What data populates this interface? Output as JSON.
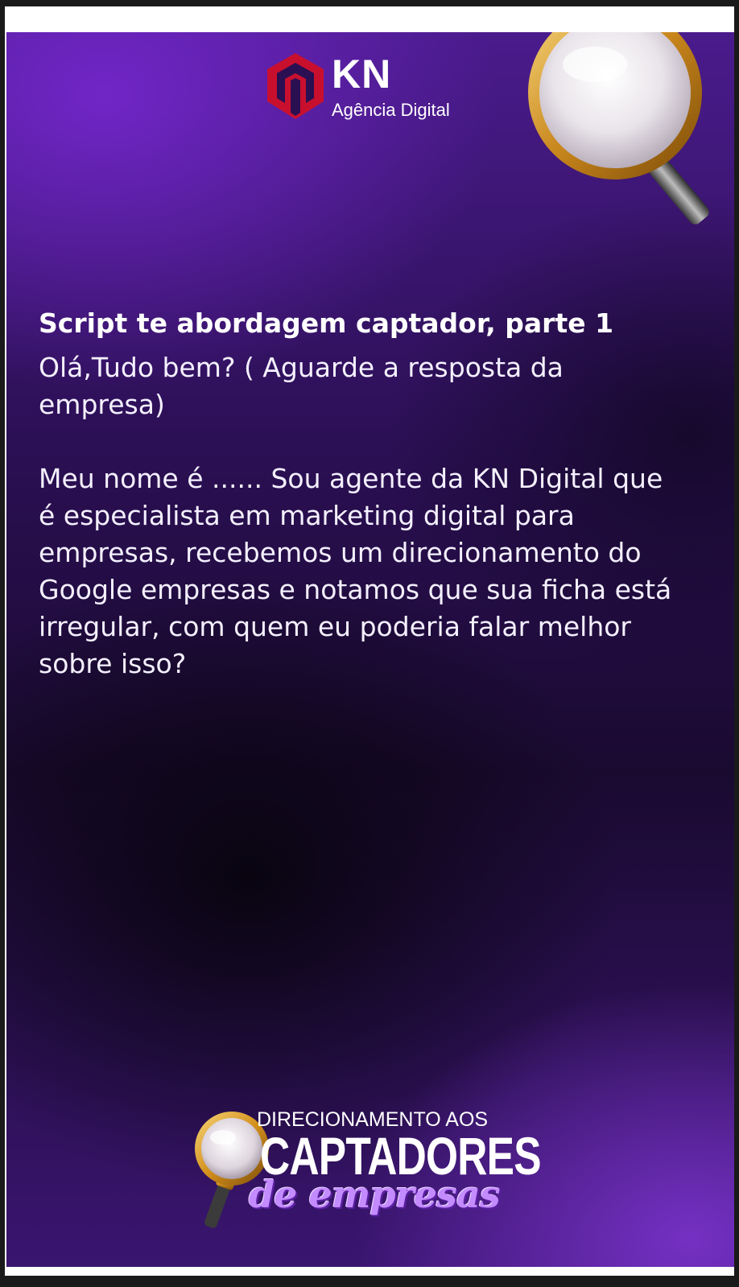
{
  "logo": {
    "word": "KN",
    "subtitle": "Agência Digital",
    "mark_icon": "kn-shield-mark"
  },
  "decor": {
    "magnifier_icon": "magnifying-glass-icon"
  },
  "content": {
    "heading": "Script te abordagem captador, parte 1",
    "paragraphs": [
      "Olá,Tudo bem?  ( Aguarde a resposta da empresa)",
      "Meu nome é ...... Sou agente da KN Digital que é especialista em marketing digital para empresas, recebemos um direcionamento do Google empresas e notamos que sua ficha está irregular, com quem eu poderia falar melhor sobre isso?"
    ]
  },
  "brand": {
    "line1": "DIRECIONAMENTO AOS",
    "line2": "CAPTADORES",
    "line3": "de empresas"
  },
  "colors": {
    "background_purple": "#4a1b8c",
    "logo_red": "#c8102e",
    "brand_lilac": "#c38bff"
  }
}
